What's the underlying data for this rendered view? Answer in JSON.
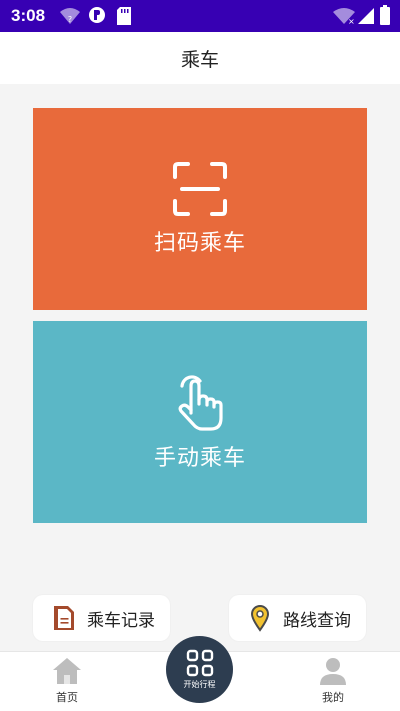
{
  "status_bar": {
    "time": "3:08"
  },
  "header": {
    "title": "乘车"
  },
  "cards": {
    "scan": {
      "label": "扫码乘车",
      "color": "#e86a3b"
    },
    "manual": {
      "label": "手动乘车",
      "color": "#5bb7c6"
    }
  },
  "quick_actions": {
    "record_label": "乘车记录",
    "route_label": "路线查询"
  },
  "tabbar": {
    "home_label": "首页",
    "start_trip_label": "开始行程",
    "mine_label": "我的"
  },
  "icons": {
    "scan": "scan-frame-icon",
    "manual": "tap-hand-icon",
    "record": "document-icon",
    "route": "location-pin-icon",
    "home": "home-icon",
    "start": "qr-code-icon",
    "mine": "user-icon"
  }
}
